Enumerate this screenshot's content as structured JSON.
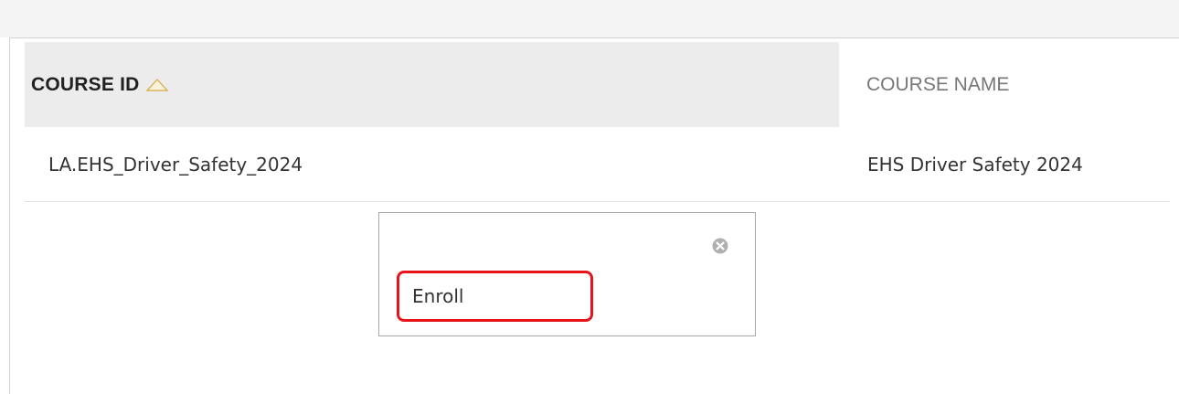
{
  "table": {
    "columns": {
      "course_id": "COURSE ID",
      "course_name": "COURSE NAME"
    },
    "sort": {
      "column": "course_id",
      "direction": "ascending",
      "icon": "sort-ascending-icon"
    },
    "rows": [
      {
        "course_id": "LA.EHS_Driver_Safety_2024",
        "course_name": "EHS Driver Safety 2024"
      }
    ]
  },
  "context_menu": {
    "close_icon": "close-circle-icon",
    "items": [
      {
        "label": "Enroll",
        "highlighted": true
      }
    ]
  },
  "colors": {
    "header_background": "#ececec",
    "highlight": "#e8141c",
    "close_icon": "#b0b0b0",
    "sort_icon": "#d9b45a"
  }
}
